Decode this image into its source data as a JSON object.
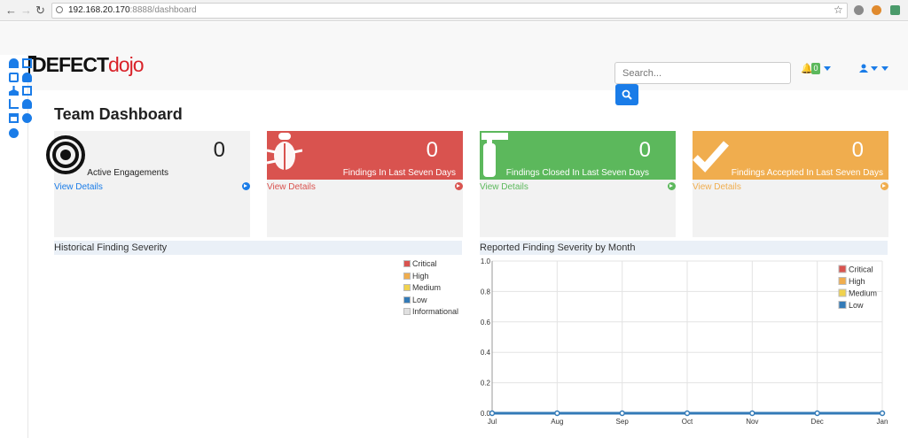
{
  "browser": {
    "url_host": "192.168.20.170",
    "url_path": ":8888/dashboard"
  },
  "app": {
    "logo_main": "DEFECT",
    "logo_accent": "dojo",
    "search_placeholder": "Search...",
    "notification_count": "0"
  },
  "page": {
    "title": "Team Dashboard"
  },
  "cards": [
    {
      "value": "0",
      "label": "Active Engagements",
      "link": "View Details",
      "color": "#f2f2f2",
      "icon": "target-icon"
    },
    {
      "value": "0",
      "label": "Findings In Last Seven Days",
      "link": "View Details",
      "color": "#d9534f",
      "icon": "bug-icon"
    },
    {
      "value": "0",
      "label": "Findings Closed In Last Seven Days",
      "link": "View Details",
      "color": "#5cb85c",
      "icon": "fire-extinguisher-icon"
    },
    {
      "value": "0",
      "label": "Findings Accepted In Last Seven Days",
      "link": "View Details",
      "color": "#f0ad4e",
      "icon": "check-icon"
    }
  ],
  "panels": {
    "historical_title": "Historical Finding Severity",
    "monthly_title": "Reported Finding Severity by Month"
  },
  "historical_legend": [
    {
      "label": "Critical",
      "color": "#d9534f"
    },
    {
      "label": "High",
      "color": "#f0ad4e"
    },
    {
      "label": "Medium",
      "color": "#f0d24e"
    },
    {
      "label": "Low",
      "color": "#337ab7"
    },
    {
      "label": "Informational",
      "color": "#e0e0e0"
    }
  ],
  "chart_data": {
    "type": "line",
    "title": "Reported Finding Severity by Month",
    "categories": [
      "Jul",
      "Aug",
      "Sep",
      "Oct",
      "Nov",
      "Dec",
      "Jan"
    ],
    "yticks": [
      "0.0",
      "0.2",
      "0.4",
      "0.6",
      "0.8",
      "1.0"
    ],
    "ylim": [
      0,
      1
    ],
    "series": [
      {
        "name": "Critical",
        "color": "#d9534f",
        "values": [
          0,
          0,
          0,
          0,
          0,
          0,
          0
        ]
      },
      {
        "name": "High",
        "color": "#f0ad4e",
        "values": [
          0,
          0,
          0,
          0,
          0,
          0,
          0
        ]
      },
      {
        "name": "Medium",
        "color": "#f0d24e",
        "values": [
          0,
          0,
          0,
          0,
          0,
          0,
          0
        ]
      },
      {
        "name": "Low",
        "color": "#337ab7",
        "values": [
          0,
          0,
          0,
          0,
          0,
          0,
          0
        ]
      }
    ],
    "grid": true,
    "legend": "top-right"
  }
}
